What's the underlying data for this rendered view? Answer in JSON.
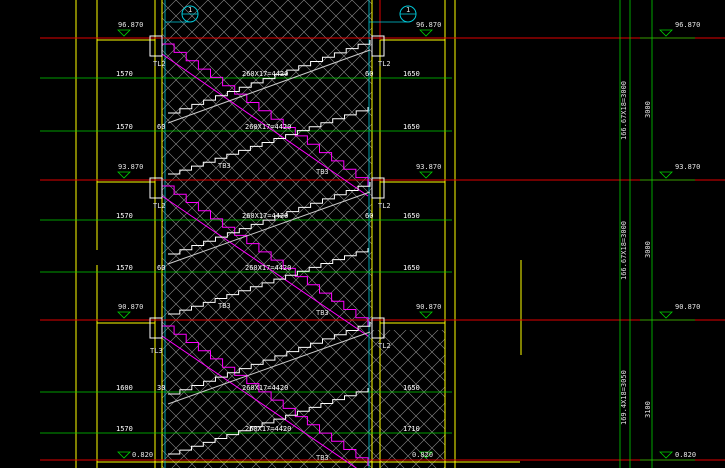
{
  "colors": {
    "background": "#000000",
    "floor_line": "#e00000",
    "dim_line": "#00d000",
    "wall": "#ffff00",
    "stair_flight": "#ff00ff",
    "stair_outline": "#ffffff",
    "hatch": "#9a9a9a",
    "axis_line": "#00c8d8",
    "text": "#e6e6e6"
  },
  "axis_markers": [
    {
      "label": "1",
      "icon": "axis-bubble-icon"
    },
    {
      "label": "1",
      "icon": "axis-bubble-icon"
    }
  ],
  "elevations": {
    "level_a": {
      "left": "96.870",
      "right": "96.870"
    },
    "level_b": {
      "left": "93.870",
      "right": "93.870"
    },
    "level_c": {
      "left": "90.870",
      "right": "90.870"
    },
    "level_d": {
      "left": "0.820",
      "right": "0.820"
    },
    "right_column": [
      "96.870",
      "93.870",
      "90.870",
      "0.820"
    ]
  },
  "beam_tags": [
    "TL2",
    "TL2",
    "TL2",
    "TL2",
    "TL3",
    "TL2"
  ],
  "flight_tags": [
    "TB3",
    "TB3",
    "TB3",
    "TB3",
    "TB3"
  ],
  "dimensions": {
    "left": [
      "1570",
      "1570",
      "1570",
      "1570",
      "1600",
      "1570"
    ],
    "right": [
      "1650",
      "1650",
      "1650",
      "1650",
      "1650",
      "1710"
    ],
    "mid_small": [
      "60",
      "60",
      "60",
      "60",
      "60",
      "30"
    ],
    "flight": [
      "260X17=4420",
      "260X17=4420",
      "260X17=4420",
      "260X17=4420",
      "260X17=4420",
      "260X17=4420"
    ]
  },
  "vertical_dims": {
    "texts": [
      "166.67X18=3000",
      "166.67X18=3000",
      "169.4X18=3050"
    ],
    "totals": [
      "3000",
      "3000",
      "3100"
    ]
  }
}
